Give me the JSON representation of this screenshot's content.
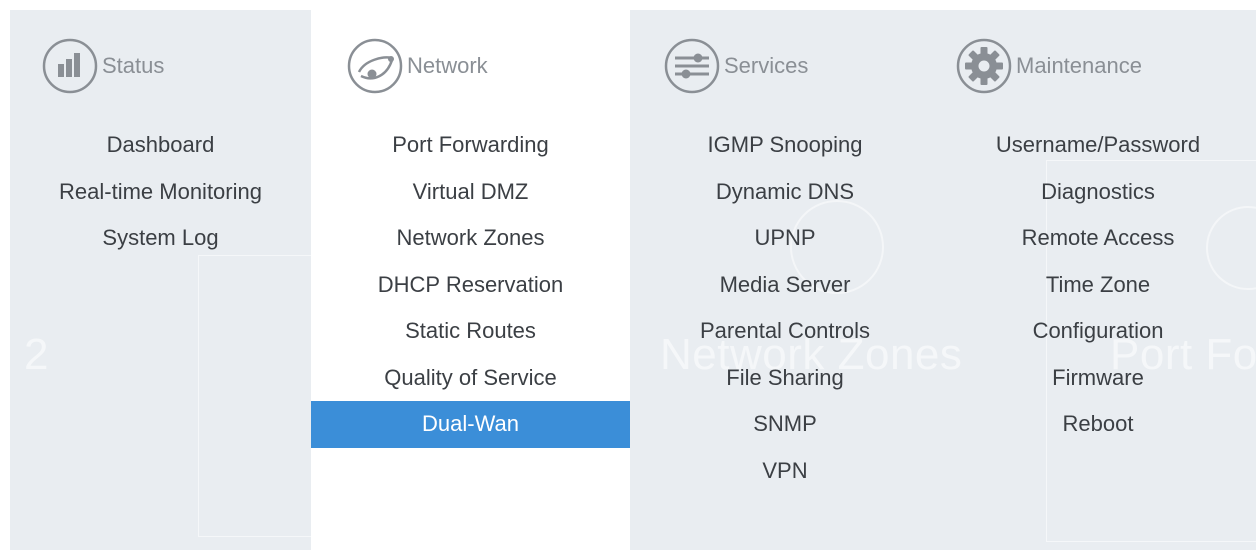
{
  "menu": {
    "status": {
      "label": "Status",
      "icon": "bar-chart-icon",
      "items": [
        "Dashboard",
        "Real-time Monitoring",
        "System Log"
      ]
    },
    "network": {
      "label": "Network",
      "icon": "globe-link-icon",
      "items": [
        "Port Forwarding",
        "Virtual DMZ",
        "Network Zones",
        "DHCP Reservation",
        "Static Routes",
        "Quality of Service",
        "Dual-Wan"
      ],
      "active_item": "Dual-Wan"
    },
    "services": {
      "label": "Services",
      "icon": "sliders-icon",
      "items": [
        "IGMP Snooping",
        "Dynamic DNS",
        "UPNP",
        "Media Server",
        "Parental Controls",
        "File Sharing",
        "SNMP",
        "VPN"
      ]
    },
    "maintenance": {
      "label": "Maintenance",
      "icon": "gear-icon",
      "items": [
        "Username/Password",
        "Diagnostics",
        "Remote Access",
        "Time Zone",
        "Configuration",
        "Firmware",
        "Reboot"
      ]
    }
  },
  "background": {
    "text_1": "Network Zones",
    "text_2": "Port Fo",
    "text_3": "2"
  },
  "colors": {
    "accent": "#3b8ed8",
    "panel_bg": "#e9edf1",
    "text": "#3b3f44",
    "header_text": "#8a8f95"
  }
}
